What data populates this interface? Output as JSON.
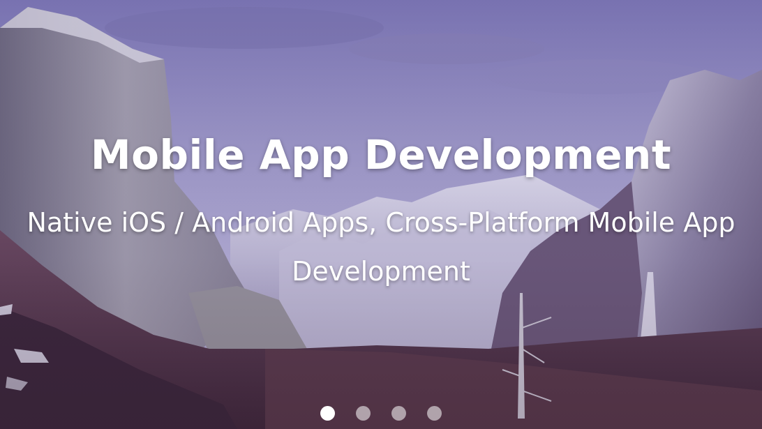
{
  "hero": {
    "title": "Mobile App Development",
    "subtitle": "Native iOS / Android Apps, Cross-Platform Mobile App Development"
  },
  "carousel": {
    "slide_count": 4,
    "active_index": 0
  },
  "colors": {
    "text": "#ffffff",
    "dot_active": "#ffffff",
    "dot_inactive": "#b8b4c8",
    "tint": "#6a5fa8"
  }
}
